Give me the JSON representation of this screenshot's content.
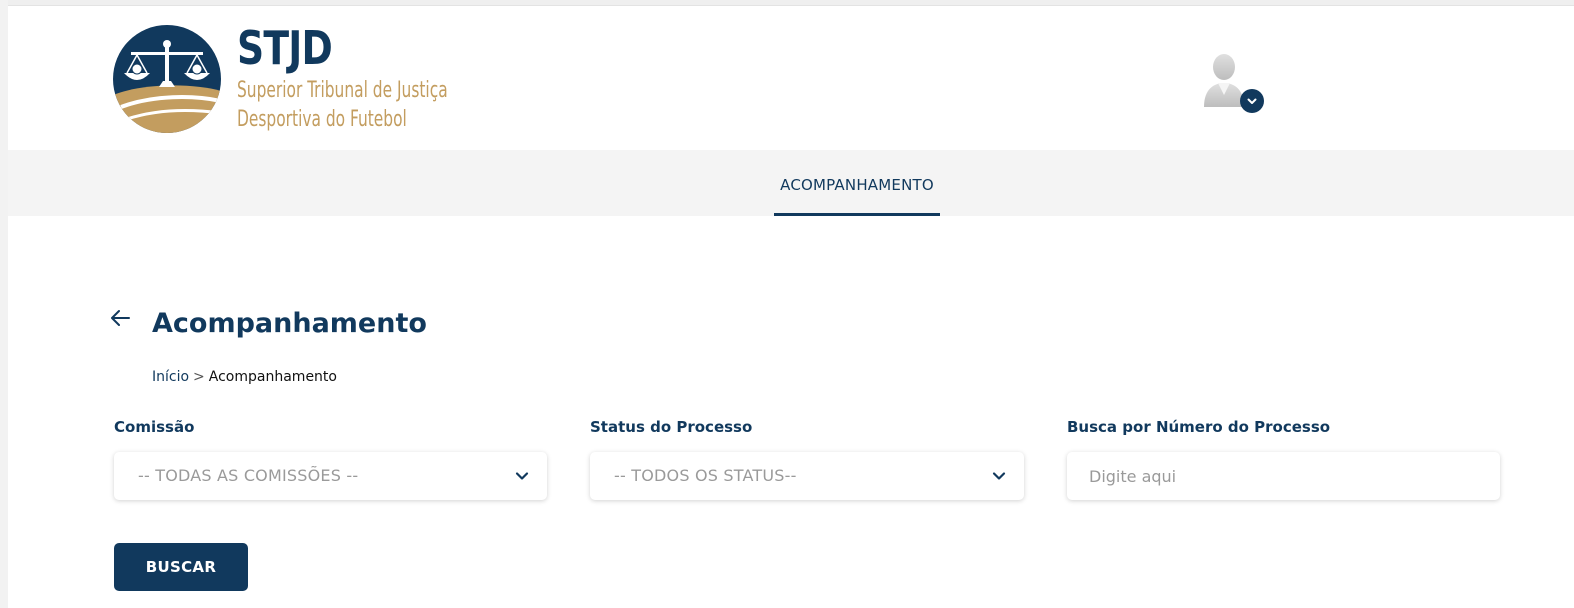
{
  "brand": {
    "acronym": "STJD",
    "subtitle_line1": "Superior Tribunal de Justiça",
    "subtitle_line2": "Desportiva do Futebol",
    "colors": {
      "primary": "#11395d",
      "gold": "#c39d5f"
    }
  },
  "header": {
    "user_menu_icon": "user-avatar-icon",
    "user_menu_chevron_icon": "chevron-down-icon"
  },
  "nav": {
    "tabs": [
      {
        "label": "ACOMPANHAMENTO",
        "active": true
      }
    ]
  },
  "page": {
    "title": "Acompanhamento",
    "back_icon": "arrow-left-icon",
    "breadcrumb": {
      "home": "Início",
      "separator": ">",
      "current": "Acompanhamento"
    }
  },
  "filters": {
    "comissao": {
      "label": "Comissão",
      "selected": "-- TODAS AS COMISSÕES --"
    },
    "status": {
      "label": "Status do Processo",
      "selected": "-- TODOS OS STATUS--"
    },
    "numero": {
      "label": "Busca por Número do Processo",
      "placeholder": "Digite aqui",
      "value": ""
    }
  },
  "actions": {
    "search_label": "BUSCAR"
  }
}
